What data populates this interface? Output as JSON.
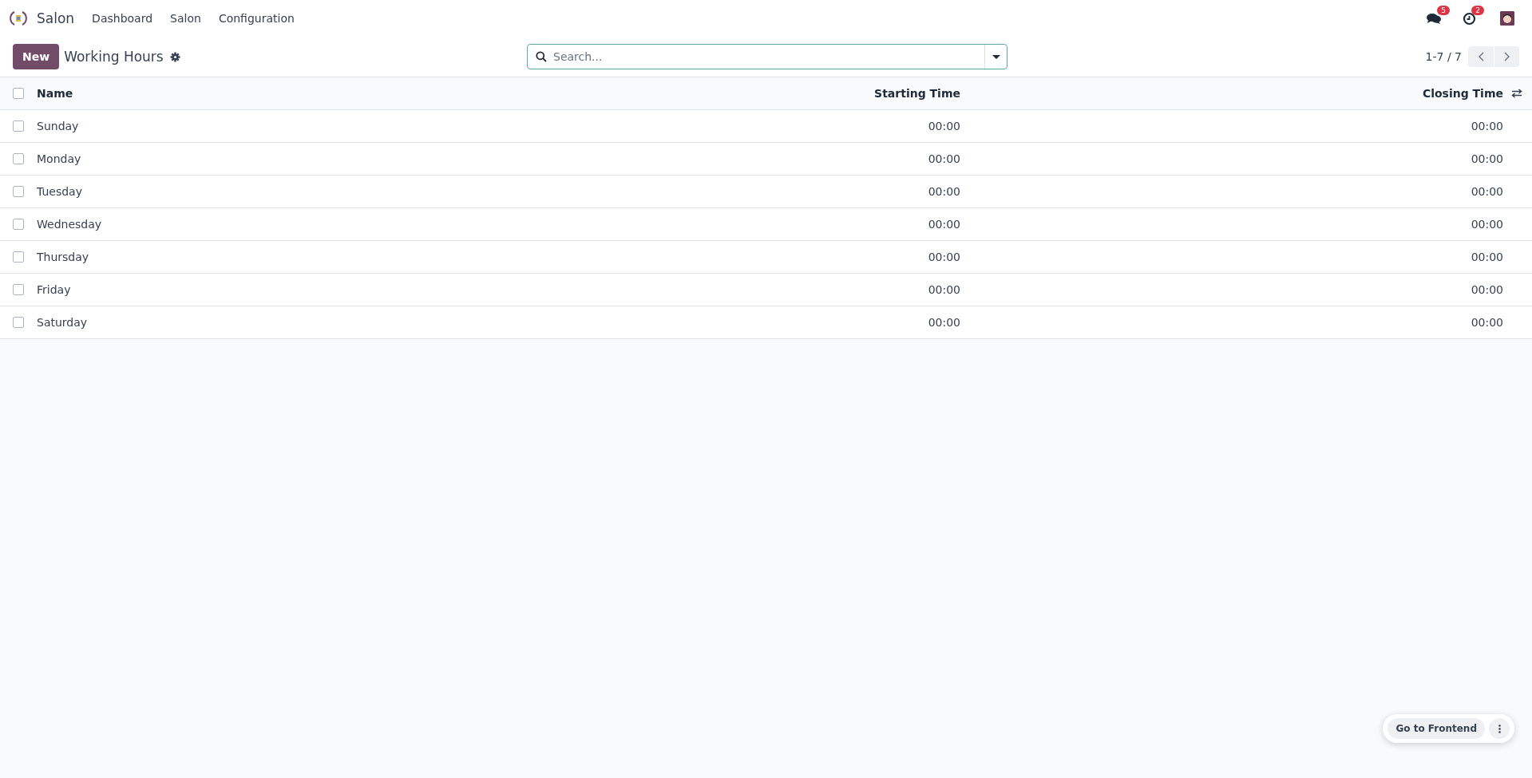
{
  "navbar": {
    "app_name": "Salon",
    "menu": [
      "Dashboard",
      "Salon",
      "Configuration"
    ],
    "messages_count": "5",
    "activities_count": "2"
  },
  "control_panel": {
    "new_button": "New",
    "title": "Working Hours",
    "search": {
      "placeholder": "Search..."
    },
    "pager": "1-7 / 7"
  },
  "table": {
    "select_all_checked": false,
    "columns": [
      "Name",
      "Starting Time",
      "Closing Time"
    ],
    "rows": [
      {
        "name": "Sunday",
        "starting_time": "00:00",
        "closing_time": "00:00",
        "checked": false
      },
      {
        "name": "Monday",
        "starting_time": "00:00",
        "closing_time": "00:00",
        "checked": false
      },
      {
        "name": "Tuesday",
        "starting_time": "00:00",
        "closing_time": "00:00",
        "checked": false
      },
      {
        "name": "Wednesday",
        "starting_time": "00:00",
        "closing_time": "00:00",
        "checked": false
      },
      {
        "name": "Thursday",
        "starting_time": "00:00",
        "closing_time": "00:00",
        "checked": false
      },
      {
        "name": "Friday",
        "starting_time": "00:00",
        "closing_time": "00:00",
        "checked": false
      },
      {
        "name": "Saturday",
        "starting_time": "00:00",
        "closing_time": "00:00",
        "checked": false
      }
    ]
  },
  "frontend_button": "Go to Frontend"
}
